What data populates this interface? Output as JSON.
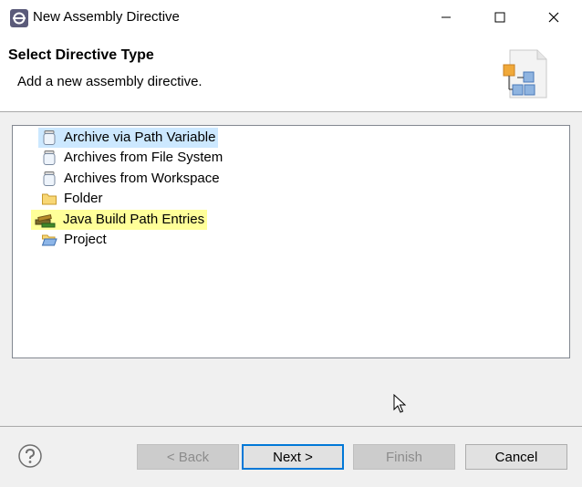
{
  "window": {
    "title": "New Assembly Directive",
    "controls": {
      "minimize": "minimize-icon",
      "maximize": "maximize-icon",
      "close": "close-icon"
    }
  },
  "banner": {
    "title": "Select Directive Type",
    "description": "Add a new assembly directive."
  },
  "directive_types": [
    {
      "label": "Archive via Path Variable",
      "icon": "jar-icon",
      "state": "selected"
    },
    {
      "label": "Archives from File System",
      "icon": "jar-icon",
      "state": "normal"
    },
    {
      "label": "Archives from Workspace",
      "icon": "jar-icon",
      "state": "normal"
    },
    {
      "label": "Folder",
      "icon": "folder-icon",
      "state": "normal"
    },
    {
      "label": "Java Build Path Entries",
      "icon": "library-icon",
      "state": "highlighted"
    },
    {
      "label": "Project",
      "icon": "open-folder-icon",
      "state": "normal"
    }
  ],
  "buttons": {
    "back": "< Back",
    "next": "Next >",
    "finish": "Finish",
    "cancel": "Cancel"
  },
  "colors": {
    "selection": "#cce8ff",
    "highlight": "#ffff99",
    "default_button_border": "#0078d7"
  }
}
